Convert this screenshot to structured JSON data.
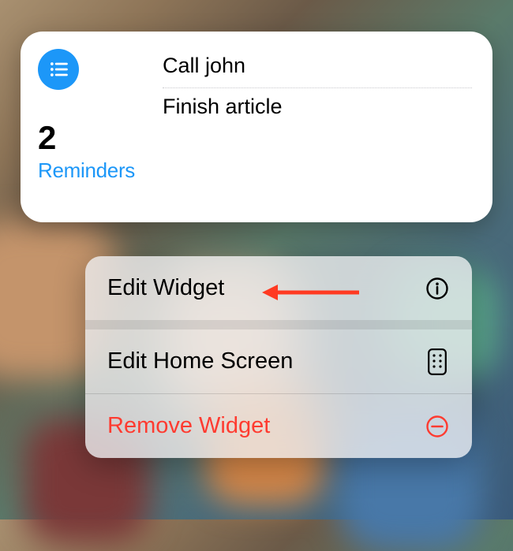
{
  "widget": {
    "count": "2",
    "title": "Reminders",
    "items": [
      "Call john",
      "Finish article"
    ]
  },
  "menu": {
    "editWidget": "Edit Widget",
    "editHomeScreen": "Edit Home Screen",
    "removeWidget": "Remove Widget"
  }
}
